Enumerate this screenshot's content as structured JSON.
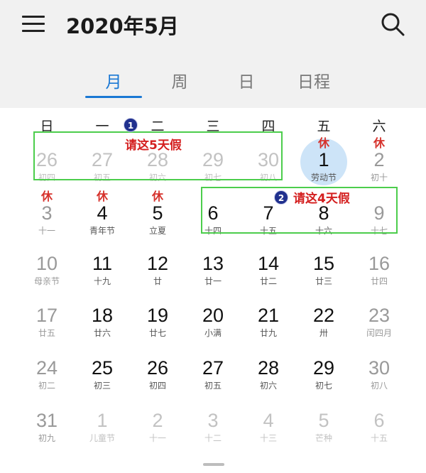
{
  "header": {
    "title": "2020年5月"
  },
  "tabs": [
    {
      "label": "月",
      "active": true
    },
    {
      "label": "周",
      "active": false
    },
    {
      "label": "日",
      "active": false
    },
    {
      "label": "日程",
      "active": false
    }
  ],
  "weekdays": [
    "日",
    "一",
    "二",
    "三",
    "四",
    "五",
    "六"
  ],
  "weeks": [
    [
      {
        "n": "26",
        "s": "初四",
        "t": "faint"
      },
      {
        "n": "27",
        "s": "初五",
        "t": "faint"
      },
      {
        "n": "28",
        "s": "初六",
        "t": "faint"
      },
      {
        "n": "29",
        "s": "初七",
        "t": "faint"
      },
      {
        "n": "30",
        "s": "初八",
        "t": "faint"
      },
      {
        "n": "1",
        "s": "劳动节",
        "t": "normal",
        "rest": "休",
        "today": true
      },
      {
        "n": "2",
        "s": "初十",
        "t": "gray",
        "rest": "休"
      }
    ],
    [
      {
        "n": "3",
        "s": "十一",
        "t": "gray",
        "rest": "休"
      },
      {
        "n": "4",
        "s": "青年节",
        "t": "normal",
        "rest": "休"
      },
      {
        "n": "5",
        "s": "立夏",
        "t": "normal",
        "rest": "休"
      },
      {
        "n": "6",
        "s": "十四",
        "t": "normal"
      },
      {
        "n": "7",
        "s": "十五",
        "t": "normal"
      },
      {
        "n": "8",
        "s": "十六",
        "t": "normal"
      },
      {
        "n": "9",
        "s": "十七",
        "t": "gray"
      }
    ],
    [
      {
        "n": "10",
        "s": "母亲节",
        "t": "gray"
      },
      {
        "n": "11",
        "s": "十九",
        "t": "normal"
      },
      {
        "n": "12",
        "s": "廿",
        "t": "normal"
      },
      {
        "n": "13",
        "s": "廿一",
        "t": "normal"
      },
      {
        "n": "14",
        "s": "廿二",
        "t": "normal"
      },
      {
        "n": "15",
        "s": "廿三",
        "t": "normal"
      },
      {
        "n": "16",
        "s": "廿四",
        "t": "gray"
      }
    ],
    [
      {
        "n": "17",
        "s": "廿五",
        "t": "gray"
      },
      {
        "n": "18",
        "s": "廿六",
        "t": "normal"
      },
      {
        "n": "19",
        "s": "廿七",
        "t": "normal"
      },
      {
        "n": "20",
        "s": "小满",
        "t": "normal"
      },
      {
        "n": "21",
        "s": "廿九",
        "t": "normal"
      },
      {
        "n": "22",
        "s": "卅",
        "t": "normal"
      },
      {
        "n": "23",
        "s": "闰四月",
        "t": "gray"
      }
    ],
    [
      {
        "n": "24",
        "s": "初二",
        "t": "gray"
      },
      {
        "n": "25",
        "s": "初三",
        "t": "normal"
      },
      {
        "n": "26",
        "s": "初四",
        "t": "normal"
      },
      {
        "n": "27",
        "s": "初五",
        "t": "normal"
      },
      {
        "n": "28",
        "s": "初六",
        "t": "normal"
      },
      {
        "n": "29",
        "s": "初七",
        "t": "normal"
      },
      {
        "n": "30",
        "s": "初八",
        "t": "gray"
      }
    ],
    [
      {
        "n": "31",
        "s": "初九",
        "t": "gray"
      },
      {
        "n": "1",
        "s": "儿童节",
        "t": "faint"
      },
      {
        "n": "2",
        "s": "十一",
        "t": "faint"
      },
      {
        "n": "3",
        "s": "十二",
        "t": "faint"
      },
      {
        "n": "4",
        "s": "十三",
        "t": "faint"
      },
      {
        "n": "5",
        "s": "芒种",
        "t": "faint"
      },
      {
        "n": "6",
        "s": "十五",
        "t": "faint"
      }
    ]
  ],
  "annotations": [
    {
      "marker": "1",
      "text": "请这5天假"
    },
    {
      "marker": "2",
      "text": "请这4天假"
    }
  ],
  "colors": {
    "accent": "#1a78d4",
    "rest": "#d6312b",
    "highlight_box": "#4ccd4c",
    "today_bg": "#cde4f8"
  }
}
